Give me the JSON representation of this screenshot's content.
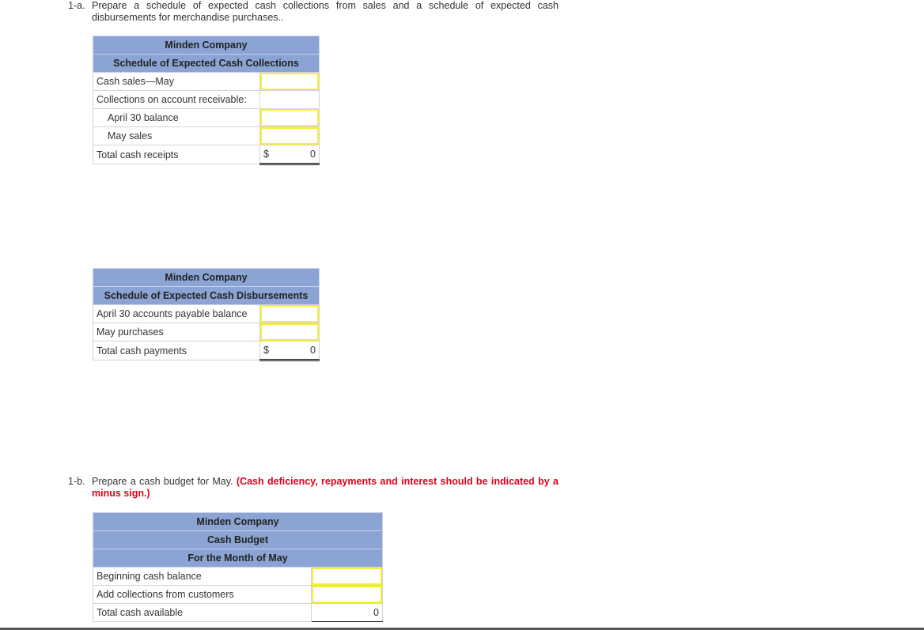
{
  "part_a": {
    "number": "1-a.",
    "instruction": "Prepare a schedule of expected cash collections from sales and a schedule of expected cash disbursements for merchandise purchases.."
  },
  "collections": {
    "company": "Minden Company",
    "title": "Schedule of Expected Cash Collections",
    "rows": [
      {
        "label": "Cash sales—May",
        "value": ""
      },
      {
        "label": "Collections on account receivable:"
      },
      {
        "label": "April 30 balance",
        "value": ""
      },
      {
        "label": "May sales",
        "value": ""
      }
    ],
    "total": {
      "label": "Total cash receipts",
      "currency": "$",
      "value": "0"
    }
  },
  "disbursements": {
    "company": "Minden Company",
    "title": "Schedule of Expected Cash Disbursements",
    "rows": [
      {
        "label": "April 30 accounts payable balance",
        "value": ""
      },
      {
        "label": "May purchases",
        "value": ""
      }
    ],
    "total": {
      "label": "Total cash payments",
      "currency": "$",
      "value": "0"
    }
  },
  "part_b": {
    "number": "1-b.",
    "instruction": "Prepare a cash budget for May. ",
    "note": "(Cash deficiency, repayments and interest should be indicated by a minus sign.)"
  },
  "budget": {
    "company": "Minden Company",
    "title": "Cash Budget",
    "period": "For the Month of May",
    "rows": [
      {
        "label": "Beginning cash balance",
        "value": ""
      },
      {
        "label": "Add collections from customers",
        "value": ""
      }
    ],
    "total": {
      "label": "Total cash available",
      "value": "0"
    }
  }
}
